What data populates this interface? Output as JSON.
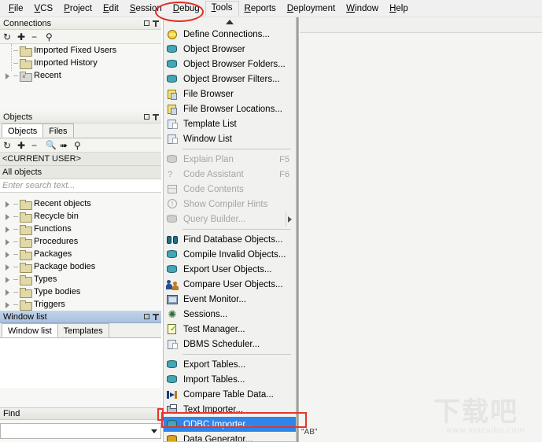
{
  "app": {
    "menubar": [
      {
        "label": "File",
        "accel": "F"
      },
      {
        "label": "VCS",
        "accel": "V"
      },
      {
        "label": "Project",
        "accel": "P"
      },
      {
        "label": "Edit",
        "accel": "E"
      },
      {
        "label": "Session",
        "accel": "S"
      },
      {
        "label": "Debug",
        "accel": "D"
      },
      {
        "label": "Tools",
        "accel": "T"
      },
      {
        "label": "Reports",
        "accel": "R"
      },
      {
        "label": "Deployment",
        "accel": "D"
      },
      {
        "label": "Window",
        "accel": "W"
      },
      {
        "label": "Help",
        "accel": "H"
      }
    ]
  },
  "connections_panel": {
    "title": "Connections",
    "items": [
      {
        "label": "Imported Fixed Users",
        "icon": "folder-icon",
        "expandable": false
      },
      {
        "label": "Imported History",
        "icon": "folder-icon",
        "expandable": false
      },
      {
        "label": "Recent",
        "icon": "folder-gray-icon",
        "expandable": true
      }
    ]
  },
  "objects_panel": {
    "title": "Objects",
    "tabs": [
      {
        "label": "Objects",
        "selected": true
      },
      {
        "label": "Files",
        "selected": false
      }
    ],
    "current_user": "<CURRENT USER>",
    "all_objects": "All objects",
    "search_placeholder": "Enter search text...",
    "items": [
      {
        "label": "Recent objects"
      },
      {
        "label": "Recycle bin"
      },
      {
        "label": "Functions"
      },
      {
        "label": "Procedures"
      },
      {
        "label": "Packages"
      },
      {
        "label": "Package bodies"
      },
      {
        "label": "Types"
      },
      {
        "label": "Type bodies"
      },
      {
        "label": "Triggers"
      }
    ]
  },
  "window_list_panel": {
    "title": "Window list",
    "tabs": [
      {
        "label": "Window list",
        "selected": true
      },
      {
        "label": "Templates",
        "selected": false
      }
    ]
  },
  "find_panel": {
    "title": "Find",
    "input_value": ""
  },
  "tools_menu": {
    "scroll_up_icon": "scroll-up-arrow-icon",
    "items": [
      {
        "label": "Define Connections...",
        "icon": "define-connections-icon",
        "state": "normal",
        "accel": "",
        "shortcut": "",
        "submenu": false
      },
      {
        "label": "Object Browser",
        "icon": "object-browser-icon",
        "state": "normal",
        "accel": "B",
        "shortcut": "",
        "submenu": false
      },
      {
        "label": "Object Browser Folders...",
        "icon": "object-browser-folders-icon",
        "state": "normal",
        "accel": "w",
        "shortcut": "",
        "submenu": false
      },
      {
        "label": "Object Browser Filters...",
        "icon": "object-browser-filters-icon",
        "state": "normal",
        "accel": "F",
        "shortcut": "",
        "submenu": false
      },
      {
        "label": "File Browser",
        "icon": "file-browser-icon",
        "state": "normal",
        "accel": "",
        "shortcut": "",
        "submenu": false
      },
      {
        "label": "File Browser Locations...",
        "icon": "file-browser-locations-icon",
        "state": "normal",
        "accel": "",
        "shortcut": "",
        "submenu": false
      },
      {
        "label": "Template List",
        "icon": "template-list-icon",
        "state": "normal",
        "accel": "e",
        "shortcut": "",
        "submenu": false
      },
      {
        "label": "Window List",
        "icon": "window-list-icon",
        "state": "normal",
        "accel": "W",
        "shortcut": "",
        "submenu": false
      },
      {
        "separator": true
      },
      {
        "label": "Explain Plan",
        "icon": "explain-plan-icon",
        "state": "disabled",
        "accel": "x",
        "shortcut": "F5",
        "submenu": false
      },
      {
        "label": "Code Assistant",
        "icon": "code-assistant-icon",
        "state": "disabled",
        "accel": "A",
        "shortcut": "F6",
        "submenu": false
      },
      {
        "label": "Code Contents",
        "icon": "code-contents-icon",
        "state": "disabled",
        "accel": "C",
        "shortcut": "",
        "submenu": false
      },
      {
        "label": "Show Compiler Hints",
        "icon": "compiler-hints-icon",
        "state": "disabled",
        "accel": "H",
        "shortcut": "",
        "submenu": false
      },
      {
        "label": "Query Builder...",
        "icon": "query-builder-icon",
        "state": "disabled",
        "accel": "Q",
        "shortcut": "",
        "submenu": true
      },
      {
        "separator": true
      },
      {
        "label": "Find Database Objects...",
        "icon": "find-database-objects-icon",
        "state": "normal",
        "accel": "D",
        "shortcut": "",
        "submenu": false
      },
      {
        "label": "Compile Invalid Objects...",
        "icon": "compile-invalid-objects-icon",
        "state": "normal",
        "accel": "n",
        "shortcut": "",
        "submenu": false
      },
      {
        "label": "Export User Objects...",
        "icon": "export-user-objects-icon",
        "state": "normal",
        "accel": "U",
        "shortcut": "",
        "submenu": false
      },
      {
        "label": "Compare User Objects...",
        "icon": "compare-user-objects-icon",
        "state": "normal",
        "accel": "O",
        "shortcut": "",
        "submenu": false
      },
      {
        "label": "Event Monitor...",
        "icon": "event-monitor-icon",
        "state": "normal",
        "accel": "v",
        "shortcut": "",
        "submenu": false
      },
      {
        "label": "Sessions...",
        "icon": "sessions-icon",
        "state": "normal",
        "accel": "S",
        "shortcut": "",
        "submenu": false
      },
      {
        "label": "Test Manager...",
        "icon": "test-manager-icon",
        "state": "normal",
        "accel": "",
        "shortcut": "",
        "submenu": false
      },
      {
        "label": "DBMS Scheduler...",
        "icon": "dbms-scheduler-icon",
        "state": "normal",
        "accel": "",
        "shortcut": "",
        "submenu": false
      },
      {
        "separator": true
      },
      {
        "label": "Export Tables...",
        "icon": "export-tables-icon",
        "state": "normal",
        "accel": "x",
        "shortcut": "",
        "submenu": false
      },
      {
        "label": "Import Tables...",
        "icon": "import-tables-icon",
        "state": "normal",
        "accel": "l",
        "shortcut": "",
        "submenu": false
      },
      {
        "label": "Compare Table Data...",
        "icon": "compare-table-data-icon",
        "state": "normal",
        "accel": "T",
        "shortcut": "",
        "submenu": false
      },
      {
        "label": "Text Importer...",
        "icon": "text-importer-icon",
        "state": "normal",
        "accel": "",
        "shortcut": "",
        "submenu": false
      },
      {
        "label": "ODBC Importer...",
        "icon": "odbc-importer-icon",
        "state": "selected",
        "accel": "",
        "shortcut": "",
        "submenu": false
      },
      {
        "label": "Data Generator...",
        "icon": "data-generator-icon",
        "state": "normal",
        "accel": "G",
        "shortcut": "",
        "submenu": false
      }
    ]
  },
  "annotations": {
    "tools_ellipse_color": "#e02b20",
    "odbc_rect_color": "#e8352b",
    "highlight_color": "#2f86e8"
  },
  "watermark": {
    "text": "下载吧",
    "url": "www.xiazaiba.com"
  },
  "right_area": {
    "label": "\"AB\""
  }
}
